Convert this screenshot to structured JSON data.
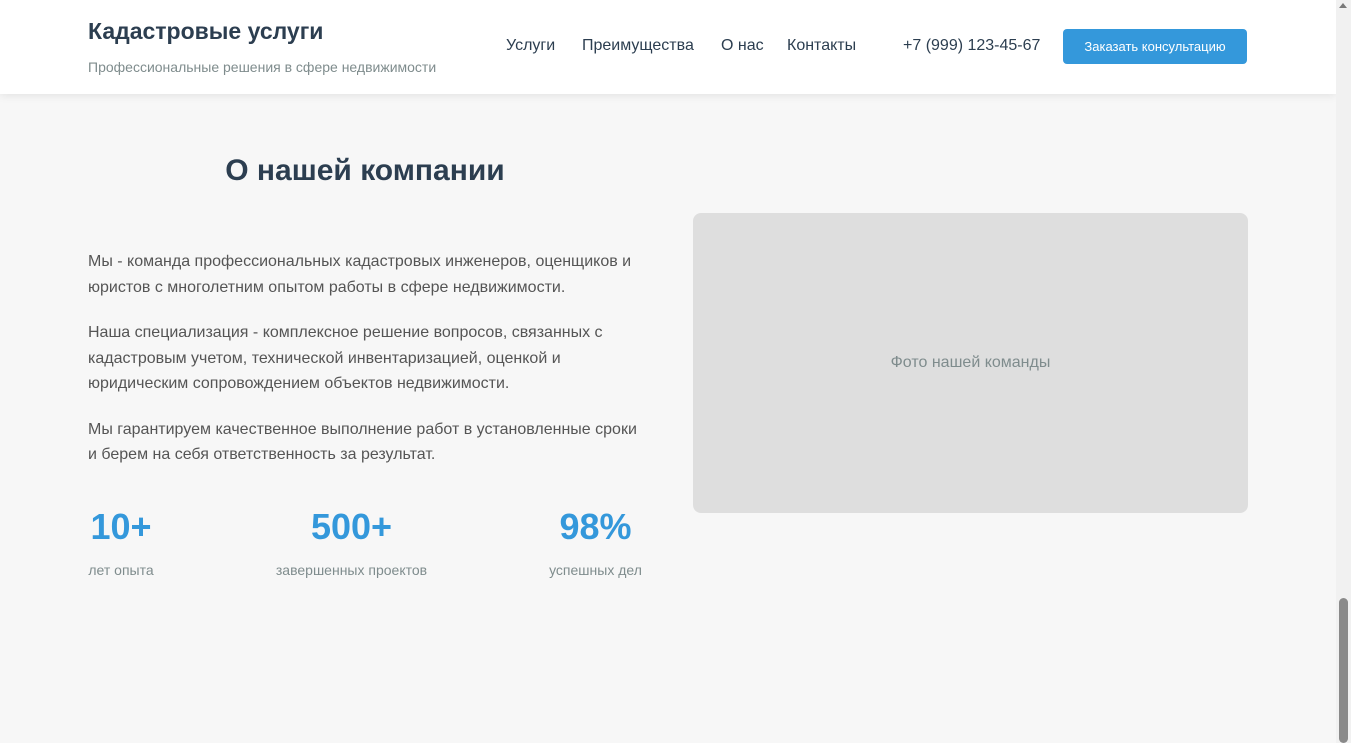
{
  "header": {
    "title": "Кадастровые услуги",
    "subtitle": "Профессиональные решения в сфере недвижимости",
    "nav": [
      "Услуги",
      "Преимущества",
      "О нас",
      "Контакты"
    ],
    "phone": "+7 (999) 123-45-67",
    "cta_label": "Заказать консультацию"
  },
  "about": {
    "title": "О нашей компании",
    "paragraphs": [
      "Мы - команда профессиональных кадастровых инженеров, оценщиков и юристов с многолетним опытом работы в сфере недвижимости.",
      "Наша специализация - комплексное решение вопросов, связанных с кадастровым учетом, технической инвентаризацией, оценкой и юридическим сопровождением объектов недвижимости.",
      "Мы гарантируем качественное выполнение работ в установленные сроки и берем на себя ответственность за результат."
    ],
    "stats": [
      {
        "value": "10+",
        "label": "лет опыта"
      },
      {
        "value": "500+",
        "label": "завершенных проектов"
      },
      {
        "value": "98%",
        "label": "успешных дел"
      }
    ],
    "photo_placeholder": "Фото нашей команды"
  },
  "colors": {
    "accent": "#3498db",
    "heading": "#2c3e50",
    "muted": "#7f8c8d",
    "background": "#f7f7f7"
  }
}
